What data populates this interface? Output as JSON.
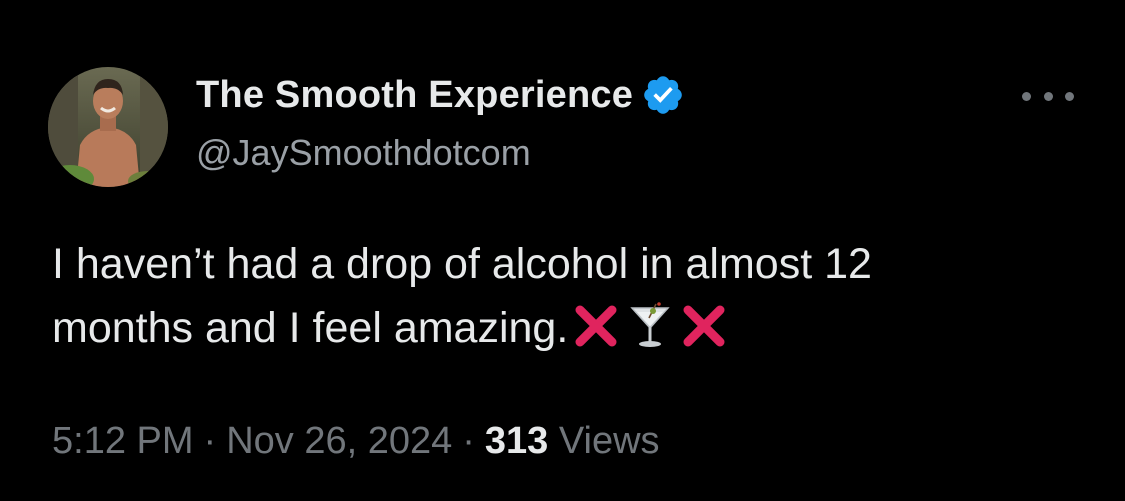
{
  "author": {
    "display_name": "The Smooth Experience",
    "handle": "@JaySmoothdotcom",
    "verified": true,
    "verified_badge_color": "#1d9bf0",
    "avatar_icon": "profile-photo"
  },
  "tweet": {
    "text_line1": "I haven’t had a drop of alcohol in almost 12",
    "text_line2": "months and I feel amazing.",
    "emojis": [
      "cross-mark",
      "cocktail-glass",
      "cross-mark"
    ]
  },
  "meta": {
    "time": "5:12 PM",
    "separator": "·",
    "date": "Nov 26, 2024",
    "views_count": "313",
    "views_label": "Views"
  },
  "more_icon": "ellipsis-icon",
  "colors": {
    "background": "#000000",
    "primary_text": "#e7e9ea",
    "secondary_text": "#71767b",
    "accent": "#1d9bf0",
    "cross_red": "#e0245e"
  }
}
